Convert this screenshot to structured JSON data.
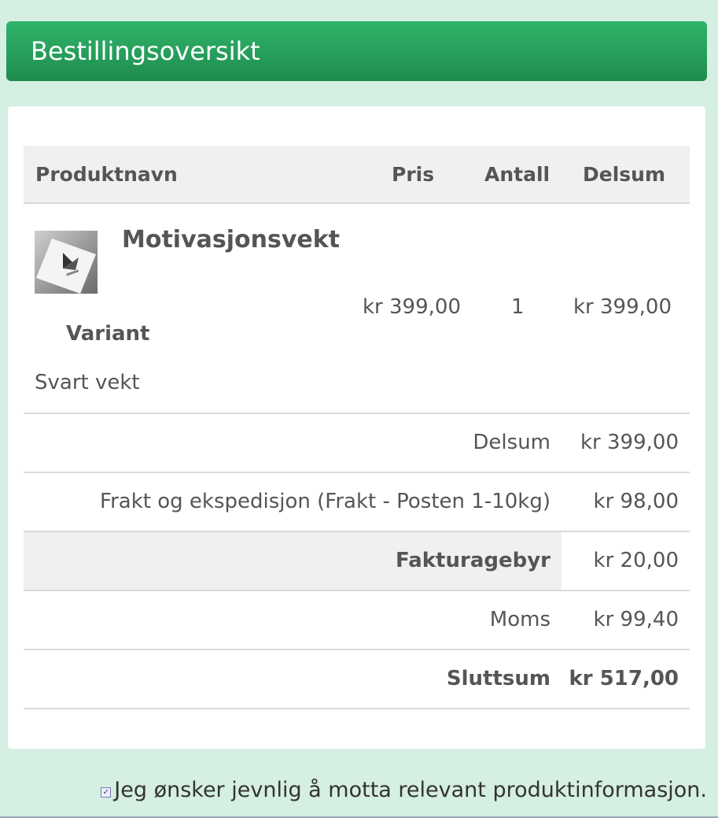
{
  "header": {
    "title": "Bestillingsoversikt"
  },
  "table": {
    "columns": {
      "product": "Produktnavn",
      "price": "Pris",
      "quantity": "Antall",
      "subtotal": "Delsum"
    },
    "items": [
      {
        "name": "Motivasjonsvekt",
        "variant_label": "Variant",
        "variant_value": "Svart vekt",
        "price": "kr 399,00",
        "quantity": "1",
        "subtotal": "kr 399,00",
        "thumbnail_icon": "product-thumbnail"
      }
    ]
  },
  "summary": {
    "subtotal_label": "Delsum",
    "subtotal_value": "kr 399,00",
    "shipping_label": "Frakt og ekspedisjon (Frakt - Posten 1-10kg)",
    "shipping_value": "kr 98,00",
    "invoice_fee_label": "Fakturagebyr",
    "invoice_fee_value": "kr 20,00",
    "vat_label": "Moms",
    "vat_value": "kr 99,40",
    "total_label": "Sluttsum",
    "total_value": "kr 517,00"
  },
  "consent": {
    "checked": true,
    "label": "Jeg ønsker jevnlig å motta relevant produktinformasjon."
  },
  "colors": {
    "header_top": "#2fb46b",
    "header_bottom": "#1f8c4e",
    "page_background": "#d5efe2"
  }
}
